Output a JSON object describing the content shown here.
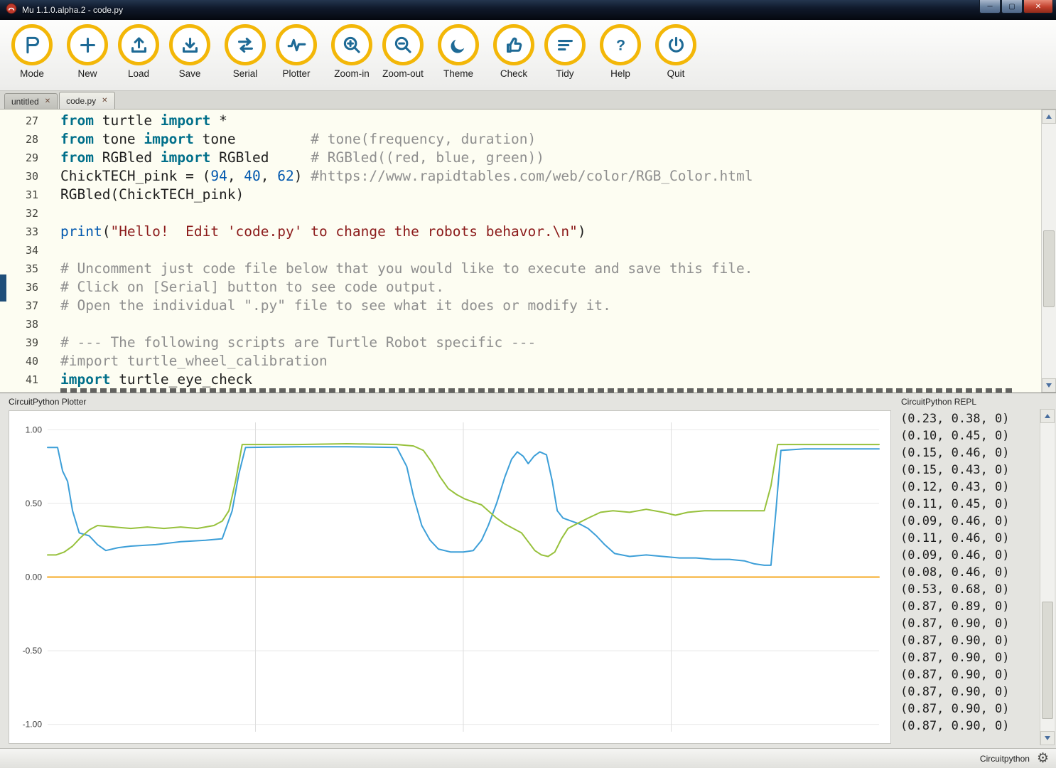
{
  "window": {
    "title": "Mu 1.1.0.alpha.2 - code.py",
    "controls": {
      "minimize": "─",
      "maximize": "▢",
      "close": "✕"
    }
  },
  "toolbar": {
    "buttons": [
      {
        "id": "mode",
        "label": "Mode",
        "icon": "mode-icon",
        "group_start": false
      },
      {
        "id": "new",
        "label": "New",
        "icon": "new-icon",
        "group_start": true
      },
      {
        "id": "load",
        "label": "Load",
        "icon": "load-icon",
        "group_start": false
      },
      {
        "id": "save",
        "label": "Save",
        "icon": "save-icon",
        "group_start": false
      },
      {
        "id": "serial",
        "label": "Serial",
        "icon": "serial-icon",
        "group_start": true
      },
      {
        "id": "plotter",
        "label": "Plotter",
        "icon": "plotter-icon",
        "group_start": false
      },
      {
        "id": "zoom-in",
        "label": "Zoom-in",
        "icon": "zoom-in-icon",
        "group_start": true
      },
      {
        "id": "zoom-out",
        "label": "Zoom-out",
        "icon": "zoom-out-icon",
        "group_start": false
      },
      {
        "id": "theme",
        "label": "Theme",
        "icon": "theme-icon",
        "group_start": true
      },
      {
        "id": "check",
        "label": "Check",
        "icon": "check-icon",
        "group_start": true
      },
      {
        "id": "tidy",
        "label": "Tidy",
        "icon": "tidy-icon",
        "group_start": false
      },
      {
        "id": "help",
        "label": "Help",
        "icon": "help-icon",
        "group_start": true
      },
      {
        "id": "quit",
        "label": "Quit",
        "icon": "quit-icon",
        "group_start": true
      }
    ]
  },
  "tabbar": {
    "close_glyph": "✕"
  },
  "tabs": [
    {
      "label": "untitled",
      "active": false
    },
    {
      "label": "code.py",
      "active": true
    }
  ],
  "editor": {
    "lines": [
      {
        "num": "27",
        "segments": [
          [
            "kw",
            "from"
          ],
          [
            "plain",
            " turtle "
          ],
          [
            "kw",
            "import"
          ],
          [
            "plain",
            " *"
          ]
        ]
      },
      {
        "num": "28",
        "segments": [
          [
            "kw",
            "from"
          ],
          [
            "plain",
            " tone "
          ],
          [
            "kw",
            "import"
          ],
          [
            "plain",
            " tone         "
          ],
          [
            "com",
            "# tone(frequency, duration)"
          ]
        ]
      },
      {
        "num": "29",
        "segments": [
          [
            "kw",
            "from"
          ],
          [
            "plain",
            " RGBled "
          ],
          [
            "kw",
            "import"
          ],
          [
            "plain",
            " RGBled     "
          ],
          [
            "com",
            "# RGBled((red, blue, green))"
          ]
        ]
      },
      {
        "num": "30",
        "segments": [
          [
            "plain",
            "ChickTECH_pink = ("
          ],
          [
            "num",
            "94"
          ],
          [
            "plain",
            ", "
          ],
          [
            "num",
            "40"
          ],
          [
            "plain",
            ", "
          ],
          [
            "num",
            "62"
          ],
          [
            "plain",
            ") "
          ],
          [
            "com",
            "#https://www.rapidtables.com/web/color/RGB_Color.html"
          ]
        ]
      },
      {
        "num": "31",
        "segments": [
          [
            "plain",
            "RGBled(ChickTECH_pink)"
          ]
        ]
      },
      {
        "num": "32",
        "segments": []
      },
      {
        "num": "33",
        "segments": [
          [
            "builtin",
            "print"
          ],
          [
            "plain",
            "("
          ],
          [
            "str",
            "\"Hello!  Edit 'code.py' to change the robots behavor.\\n\""
          ],
          [
            "plain",
            ")"
          ]
        ]
      },
      {
        "num": "34",
        "segments": []
      },
      {
        "num": "35",
        "segments": [
          [
            "com",
            "# Uncomment just code file below that you would like to execute and save this file."
          ]
        ]
      },
      {
        "num": "36",
        "segments": [
          [
            "com",
            "# Click on [Serial] button to see code output."
          ]
        ]
      },
      {
        "num": "37",
        "segments": [
          [
            "com",
            "# Open the individual \".py\" file to see what it does or modify it."
          ]
        ]
      },
      {
        "num": "38",
        "segments": []
      },
      {
        "num": "39",
        "segments": [
          [
            "com",
            "# --- The following scripts are Turtle Robot specific ---"
          ]
        ]
      },
      {
        "num": "40",
        "segments": [
          [
            "com",
            "#import turtle_wheel_calibration"
          ]
        ]
      },
      {
        "num": "41",
        "segments": [
          [
            "kw",
            "import"
          ],
          [
            "plain",
            " turtle_eye_check"
          ]
        ]
      }
    ]
  },
  "plotter": {
    "title": "CircuitPython Plotter"
  },
  "chart_data": {
    "type": "line",
    "title": "CircuitPython Plotter",
    "xlabel": "",
    "ylabel": "",
    "ylim": [
      -1.05,
      1.05
    ],
    "grid": true,
    "legend": "none",
    "yticks": [
      {
        "v": 1,
        "label": "1.00"
      },
      {
        "v": 0.5,
        "label": "0.50"
      },
      {
        "v": 0,
        "label": "0.00"
      },
      {
        "v": -0.5,
        "label": "-0.50"
      },
      {
        "v": -1,
        "label": "-1.00"
      }
    ],
    "xgrid": [
      0.25,
      0.5,
      0.75
    ],
    "series": [
      {
        "name": "blue",
        "color": "#3d9fd8",
        "points": [
          [
            0,
            0.88
          ],
          [
            0.012,
            0.88
          ],
          [
            0.018,
            0.72
          ],
          [
            0.024,
            0.65
          ],
          [
            0.03,
            0.45
          ],
          [
            0.038,
            0.3
          ],
          [
            0.05,
            0.28
          ],
          [
            0.06,
            0.22
          ],
          [
            0.07,
            0.18
          ],
          [
            0.085,
            0.2
          ],
          [
            0.1,
            0.21
          ],
          [
            0.13,
            0.22
          ],
          [
            0.16,
            0.24
          ],
          [
            0.19,
            0.25
          ],
          [
            0.21,
            0.26
          ],
          [
            0.222,
            0.45
          ],
          [
            0.23,
            0.7
          ],
          [
            0.238,
            0.88
          ],
          [
            0.3,
            0.885
          ],
          [
            0.36,
            0.885
          ],
          [
            0.42,
            0.88
          ],
          [
            0.432,
            0.75
          ],
          [
            0.44,
            0.55
          ],
          [
            0.45,
            0.35
          ],
          [
            0.46,
            0.25
          ],
          [
            0.47,
            0.19
          ],
          [
            0.485,
            0.17
          ],
          [
            0.5,
            0.17
          ],
          [
            0.512,
            0.18
          ],
          [
            0.522,
            0.25
          ],
          [
            0.53,
            0.35
          ],
          [
            0.54,
            0.5
          ],
          [
            0.55,
            0.68
          ],
          [
            0.558,
            0.8
          ],
          [
            0.565,
            0.85
          ],
          [
            0.572,
            0.82
          ],
          [
            0.578,
            0.77
          ],
          [
            0.585,
            0.82
          ],
          [
            0.592,
            0.85
          ],
          [
            0.6,
            0.83
          ],
          [
            0.607,
            0.65
          ],
          [
            0.613,
            0.45
          ],
          [
            0.62,
            0.4
          ],
          [
            0.63,
            0.38
          ],
          [
            0.64,
            0.36
          ],
          [
            0.65,
            0.33
          ],
          [
            0.66,
            0.28
          ],
          [
            0.67,
            0.22
          ],
          [
            0.682,
            0.16
          ],
          [
            0.7,
            0.14
          ],
          [
            0.72,
            0.15
          ],
          [
            0.74,
            0.14
          ],
          [
            0.76,
            0.13
          ],
          [
            0.78,
            0.13
          ],
          [
            0.8,
            0.12
          ],
          [
            0.82,
            0.12
          ],
          [
            0.838,
            0.11
          ],
          [
            0.85,
            0.09
          ],
          [
            0.862,
            0.08
          ],
          [
            0.87,
            0.08
          ],
          [
            0.876,
            0.45
          ],
          [
            0.882,
            0.86
          ],
          [
            0.91,
            0.87
          ],
          [
            0.95,
            0.87
          ],
          [
            1,
            0.87
          ]
        ]
      },
      {
        "name": "green",
        "color": "#97c13c",
        "points": [
          [
            0,
            0.15
          ],
          [
            0.01,
            0.15
          ],
          [
            0.02,
            0.17
          ],
          [
            0.03,
            0.21
          ],
          [
            0.04,
            0.27
          ],
          [
            0.05,
            0.32
          ],
          [
            0.06,
            0.35
          ],
          [
            0.08,
            0.34
          ],
          [
            0.1,
            0.33
          ],
          [
            0.12,
            0.34
          ],
          [
            0.14,
            0.33
          ],
          [
            0.16,
            0.34
          ],
          [
            0.18,
            0.33
          ],
          [
            0.2,
            0.35
          ],
          [
            0.21,
            0.38
          ],
          [
            0.218,
            0.45
          ],
          [
            0.226,
            0.65
          ],
          [
            0.234,
            0.9
          ],
          [
            0.3,
            0.9
          ],
          [
            0.36,
            0.905
          ],
          [
            0.42,
            0.9
          ],
          [
            0.44,
            0.89
          ],
          [
            0.452,
            0.86
          ],
          [
            0.462,
            0.78
          ],
          [
            0.472,
            0.68
          ],
          [
            0.482,
            0.6
          ],
          [
            0.492,
            0.56
          ],
          [
            0.502,
            0.53
          ],
          [
            0.512,
            0.51
          ],
          [
            0.522,
            0.49
          ],
          [
            0.532,
            0.44
          ],
          [
            0.54,
            0.4
          ],
          [
            0.55,
            0.36
          ],
          [
            0.56,
            0.33
          ],
          [
            0.57,
            0.3
          ],
          [
            0.578,
            0.24
          ],
          [
            0.586,
            0.18
          ],
          [
            0.594,
            0.15
          ],
          [
            0.602,
            0.14
          ],
          [
            0.61,
            0.17
          ],
          [
            0.618,
            0.26
          ],
          [
            0.626,
            0.33
          ],
          [
            0.636,
            0.36
          ],
          [
            0.65,
            0.4
          ],
          [
            0.665,
            0.44
          ],
          [
            0.68,
            0.45
          ],
          [
            0.7,
            0.44
          ],
          [
            0.72,
            0.46
          ],
          [
            0.74,
            0.44
          ],
          [
            0.755,
            0.42
          ],
          [
            0.77,
            0.44
          ],
          [
            0.79,
            0.45
          ],
          [
            0.82,
            0.45
          ],
          [
            0.85,
            0.45
          ],
          [
            0.862,
            0.45
          ],
          [
            0.87,
            0.62
          ],
          [
            0.878,
            0.9
          ],
          [
            0.92,
            0.9
          ],
          [
            0.96,
            0.9
          ],
          [
            1,
            0.9
          ]
        ]
      },
      {
        "name": "orange",
        "color": "#f6a821",
        "points": [
          [
            0,
            0
          ],
          [
            1,
            0
          ]
        ]
      }
    ]
  },
  "repl": {
    "title": "CircuitPython REPL",
    "lines": [
      "(0.23, 0.38, 0)",
      "(0.10, 0.45, 0)",
      "(0.15, 0.46, 0)",
      "(0.15, 0.43, 0)",
      "(0.12, 0.43, 0)",
      "(0.11, 0.45, 0)",
      "(0.09, 0.46, 0)",
      "(0.11, 0.46, 0)",
      "(0.09, 0.46, 0)",
      "(0.08, 0.46, 0)",
      "(0.53, 0.68, 0)",
      "(0.87, 0.89, 0)",
      "(0.87, 0.90, 0)",
      "(0.87, 0.90, 0)",
      "(0.87, 0.90, 0)",
      "(0.87, 0.90, 0)",
      "(0.87, 0.90, 0)",
      "(0.87, 0.90, 0)",
      "(0.87, 0.90, 0)"
    ]
  },
  "statusbar": {
    "mode_label": "Circuitpython",
    "gear_glyph": "⚙"
  }
}
